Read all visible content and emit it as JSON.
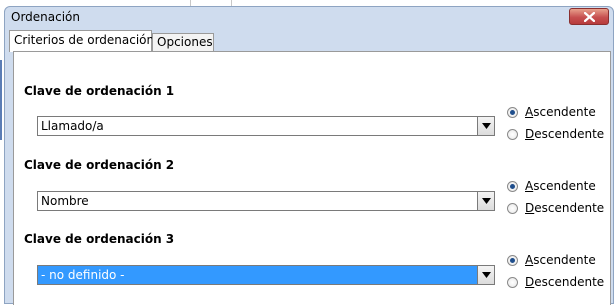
{
  "window": {
    "title": "Ordenación"
  },
  "tabs": [
    {
      "label": "Criterios de ordenación",
      "active": true
    },
    {
      "label": "Opciones",
      "active": false
    }
  ],
  "groups": [
    {
      "label": "Clave de ordenación 1",
      "value": "Llamado/a",
      "selected": false,
      "radios": [
        {
          "accel": "A",
          "rest": "scendente",
          "checked": true
        },
        {
          "accel": "D",
          "rest": "escendente",
          "checked": false
        }
      ]
    },
    {
      "label": "Clave de ordenación 2",
      "value": "Nombre",
      "selected": false,
      "radios": [
        {
          "accel": "A",
          "rest": "scendente",
          "checked": true
        },
        {
          "accel": "D",
          "rest": "escendente",
          "checked": false
        }
      ]
    },
    {
      "label": "Clave de ordenación 3",
      "value": "- no definido -",
      "selected": true,
      "radios": [
        {
          "accel": "A",
          "rest": "scendente",
          "checked": true
        },
        {
          "accel": "D",
          "rest": "escendente",
          "checked": false
        }
      ]
    }
  ],
  "colors": {
    "selection": "#3399ff",
    "close": "#c75050",
    "frame": "#cfdcee"
  }
}
